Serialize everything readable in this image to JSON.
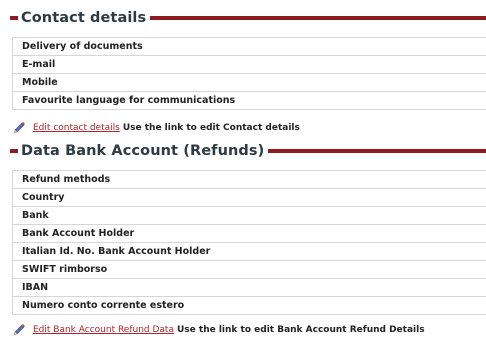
{
  "contact": {
    "title": "Contact details",
    "fields": [
      {
        "label": "Delivery of documents"
      },
      {
        "label": "E-mail"
      },
      {
        "label": "Mobile"
      },
      {
        "label": "Favourite language for communications"
      }
    ],
    "edit_link": "Edit contact details",
    "edit_hint": "Use the link to edit Contact details"
  },
  "bank": {
    "title": "Data Bank Account (Refunds)",
    "fields": [
      {
        "label": "Refund methods"
      },
      {
        "label": "Country"
      },
      {
        "label": "Bank"
      },
      {
        "label": "Bank Account Holder"
      },
      {
        "label": "Italian Id. No. Bank Account Holder"
      },
      {
        "label": "SWIFT rimborso"
      },
      {
        "label": "IBAN"
      },
      {
        "label": "Numero conto corrente estero"
      }
    ],
    "edit_link": "Edit Bank Account Refund Data",
    "edit_hint": "Use the link to edit Bank Account Refund Details"
  },
  "colors": {
    "accent": "#8e1b1f",
    "link": "#b3232a",
    "border": "#d6d6d6"
  },
  "icons": {
    "edit": "pencil-icon"
  }
}
